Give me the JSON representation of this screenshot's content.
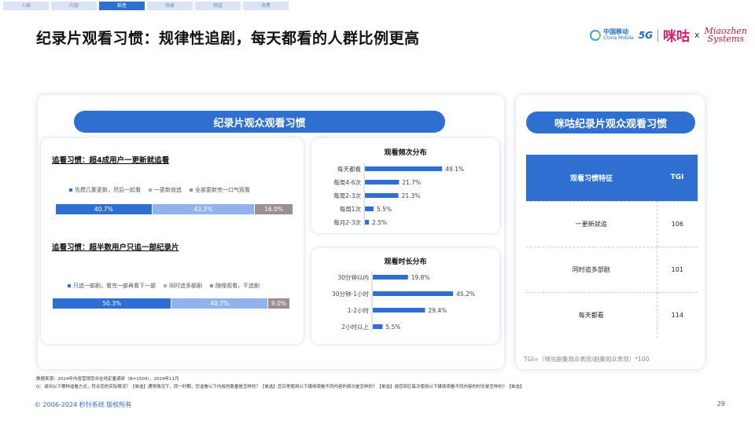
{
  "nav": {
    "tabs": [
      "人群",
      "内容",
      "粘性",
      "场景",
      "频道",
      "消费"
    ],
    "active_index": 2
  },
  "title": "纪录片观看习惯：规律性追剧，每天都看的人群比例更高",
  "logos": {
    "china_mobile_cn": "中国移动",
    "china_mobile_en": "China Mobile",
    "five_g": "5G",
    "migu": "咪咕",
    "x": "x",
    "miaozhen_line1": "Miaozhen",
    "miaozhen_line2": "Systems"
  },
  "main_card": {
    "pill_label": "纪录片观众观看习惯",
    "section1": {
      "title": "追看习惯：超4成用户一更新就追看",
      "legend": [
        "先攒几集更新，然后一起看",
        "一更新就追",
        "全部更新完一口气观看"
      ],
      "values": [
        40.7,
        43.3,
        16.0
      ],
      "labels": [
        "40.7%",
        "43.3%",
        "16.0%"
      ],
      "colors": [
        "#2e6fd1",
        "#8fb3ea",
        "#9c8e97"
      ]
    },
    "section2": {
      "title": "追看习惯：超半数用户只追一部纪录片",
      "legend": [
        "只追一部剧，看完一部再看下一部",
        "同时追多部剧",
        "随缘观看，不追剧"
      ],
      "values": [
        50.3,
        40.7,
        9.0
      ],
      "labels": [
        "50.3%",
        "40.7%",
        "9.0%"
      ],
      "colors": [
        "#2e6fd1",
        "#8fb3ea",
        "#9c8e97"
      ]
    }
  },
  "chart_data": [
    {
      "type": "bar",
      "orientation": "horizontal",
      "title": "观看频次分布",
      "categories": [
        "每天都看",
        "每周4-6次",
        "每周2-3次",
        "每周1次",
        "每月2-3次"
      ],
      "values": [
        49.1,
        21.7,
        21.3,
        5.5,
        2.5
      ],
      "labels": [
        "49.1%",
        "21.7%",
        "21.3%",
        "5.5%",
        "2.5%"
      ],
      "color": "#2e6fd1"
    },
    {
      "type": "bar",
      "orientation": "horizontal",
      "title": "观看时长分布",
      "categories": [
        "30分钟以内",
        "30分钟-1小时",
        "1-2小时",
        "2小时以上"
      ],
      "values": [
        19.8,
        45.2,
        29.4,
        5.5
      ],
      "labels": [
        "19.8%",
        "45.2%",
        "29.4%",
        "5.5%"
      ],
      "color": "#2e6fd1"
    }
  ],
  "right_card": {
    "pill_label": "咪咕纪录片观众观看习惯",
    "table": {
      "headers": [
        "观看习惯特征",
        "TGI"
      ],
      "rows": [
        [
          "一更新就追",
          "106"
        ],
        [
          "同时追多部剧",
          "101"
        ],
        [
          "每天都看",
          "114"
        ]
      ]
    },
    "tgi_note": "TGI=（咪咕剧集观众表现/剧集观众表现）*100"
  },
  "footnotes": {
    "line1": "数据来源：2024年内容营销受众在线定量调研（N=1500），2024年11月",
    "line2": "Q：请问以下哪种追看方式，符合您的实际情况？【单选】通常情况下，同一时期，您追看以下内容的数量是怎样的？【单选】您日常使用以下媒体观看不同内容的频次是怎样的？【单选】请您回忆每次使用以下媒体观看不同内容的时长是怎样的？【单选】"
  },
  "copyright": "© 2006-2024 秒针系统 版权所有",
  "page_number": "29"
}
